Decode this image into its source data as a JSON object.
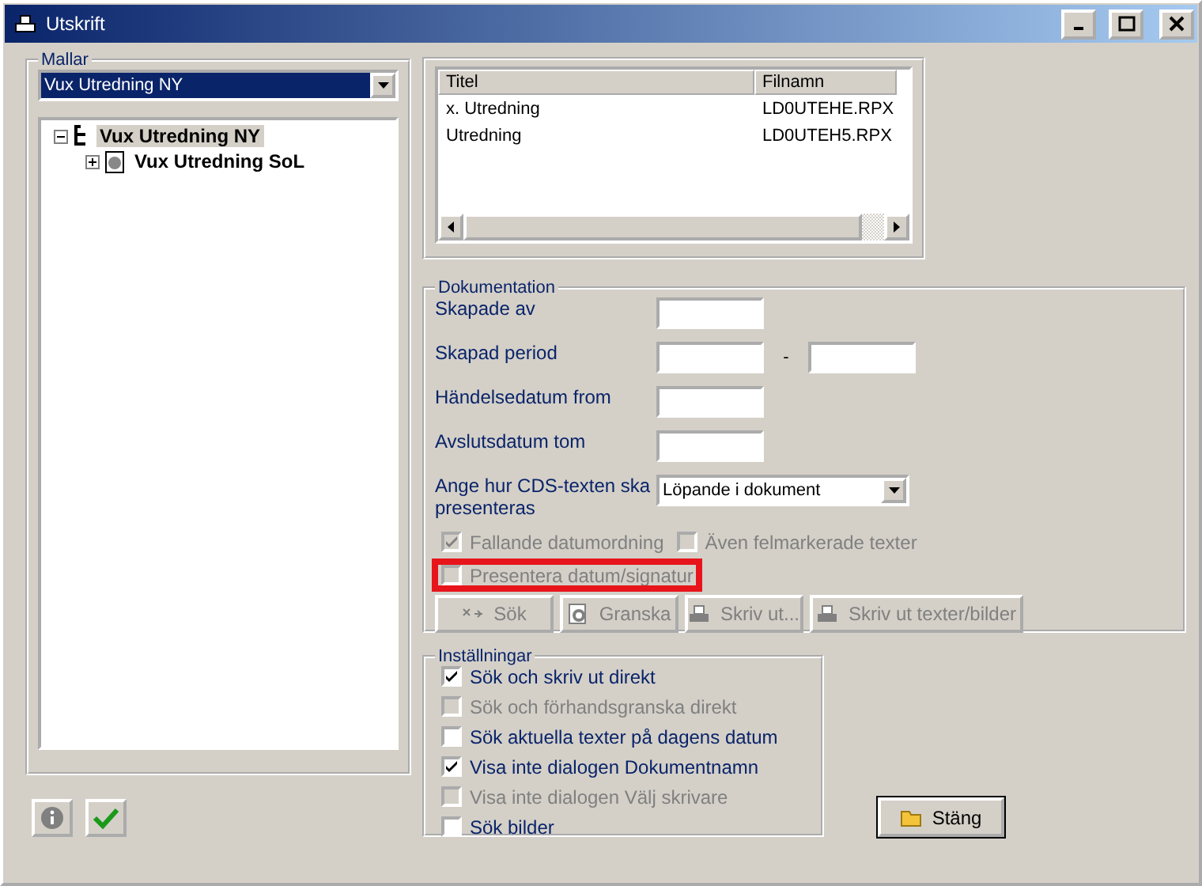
{
  "window": {
    "title": "Utskrift"
  },
  "mallar": {
    "label": "Mallar",
    "template": "Vux Utredning NY",
    "tree": [
      {
        "label": "Vux Utredning NY",
        "expanded": true,
        "selected": true,
        "children": [
          {
            "label": "Vux Utredning SoL",
            "expanded": false,
            "selected": false
          }
        ]
      }
    ]
  },
  "files": {
    "columns": [
      "Titel",
      "Filnamn"
    ],
    "rows": [
      [
        "x. Utredning",
        "LD0UTEHE.RPX"
      ],
      [
        "Utredning",
        "LD0UTEH5.RPX"
      ]
    ]
  },
  "dokumentation": {
    "label": "Dokumentation",
    "fields": [
      {
        "kind": "single",
        "label": "Skapade av"
      },
      {
        "kind": "range",
        "label": "Skapad period",
        "separator": "-"
      },
      {
        "kind": "single",
        "label": "Händelsedatum from"
      },
      {
        "kind": "single",
        "label": "Avslutsdatum tom"
      }
    ],
    "cds": {
      "label": "Ange hur CDS-texten ska presenteras",
      "value": "Löpande i dokument"
    },
    "checkboxes": [
      {
        "label": "Fallande datumordning",
        "checked": true,
        "disabled": true,
        "highlighted": false
      },
      {
        "label": "Även felmarkerade texter",
        "checked": false,
        "disabled": true,
        "highlighted": false
      },
      {
        "label": "Presentera datum/signatur",
        "checked": false,
        "disabled": true,
        "highlighted": true
      }
    ],
    "buttons": [
      {
        "kind": "search",
        "label": "Sök",
        "disabled": true
      },
      {
        "kind": "preview",
        "label": "Granska",
        "disabled": true
      },
      {
        "kind": "print",
        "label": "Skriv ut...",
        "disabled": true
      },
      {
        "kind": "print",
        "label": "Skriv ut texter/bilder",
        "disabled": true
      }
    ]
  },
  "installningar": {
    "label": "Inställningar",
    "checkboxes": [
      {
        "label": "Sök och skriv ut direkt",
        "checked": true,
        "disabled": false
      },
      {
        "label": "Sök och förhandsgranska direkt",
        "checked": false,
        "disabled": true
      },
      {
        "label": "Sök aktuella texter på dagens datum",
        "checked": false,
        "disabled": false
      },
      {
        "label": "Visa inte dialogen Dokumentnamn",
        "checked": true,
        "disabled": false
      },
      {
        "label": "Visa inte dialogen Välj skrivare",
        "checked": false,
        "disabled": true
      },
      {
        "label": "Sök bilder",
        "checked": false,
        "disabled": false
      }
    ]
  },
  "close_button": {
    "label": "Stäng"
  }
}
